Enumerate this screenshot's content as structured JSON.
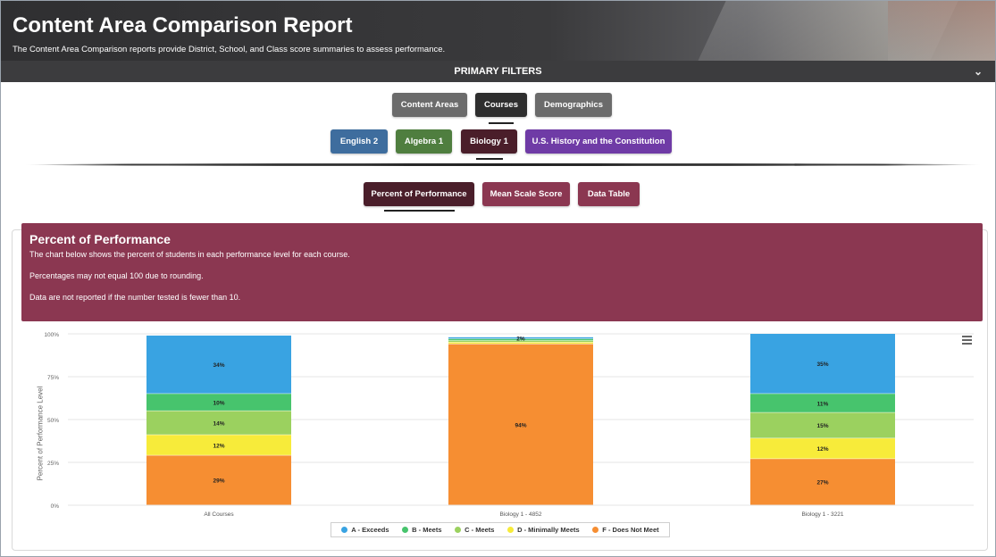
{
  "header": {
    "title": "Content Area Comparison Report",
    "subtitle": "The Content Area Comparison reports provide District, School, and Class score summaries to assess performance."
  },
  "filters_bar": {
    "label": "PRIMARY FILTERS",
    "chevron_icon": "chevron-down-icon"
  },
  "filter_tabs": [
    {
      "label": "Content Areas",
      "color": "#6b6b6b",
      "selected": false
    },
    {
      "label": "Courses",
      "color": "#2e2e2e",
      "selected": true
    },
    {
      "label": "Demographics",
      "color": "#6b6b6b",
      "selected": false
    }
  ],
  "course_tabs": [
    {
      "label": "English 2",
      "color": "#3e6d9e",
      "selected": false
    },
    {
      "label": "Algebra 1",
      "color": "#4f7e3f",
      "selected": false
    },
    {
      "label": "Biology 1",
      "color": "#4a1e2a",
      "selected": true
    },
    {
      "label": "U.S. History and the Constitution",
      "color": "#6f3ba6",
      "selected": false
    }
  ],
  "view_tabs": [
    {
      "label": "Percent of Performance",
      "color": "#4a1e2a",
      "selected": true
    },
    {
      "label": "Mean Scale Score",
      "color": "#8b3751",
      "selected": false
    },
    {
      "label": "Data Table",
      "color": "#8b3751",
      "selected": false
    }
  ],
  "info": {
    "title": "Percent of Performance",
    "line1": "The chart below shows the percent of students in each performance level for each course.",
    "line2": "Percentages may not equal 100 due to rounding.",
    "line3": "Data are not reported if the number tested is fewer than 10."
  },
  "chart_data": {
    "type": "bar",
    "stacked": true,
    "ylabel": "Percent of Performance Level",
    "ylim": [
      0,
      100
    ],
    "yticks": [
      "0%",
      "25%",
      "50%",
      "75%",
      "100%"
    ],
    "categories": [
      "All Courses",
      "Biology 1 - 4852",
      "Biology 1 - 3221"
    ],
    "series": [
      {
        "name": "F - Does Not Meet",
        "color": "#f68e32",
        "values": [
          29,
          94,
          27
        ],
        "labels": [
          "29%",
          "94%",
          "27%"
        ]
      },
      {
        "name": "D - Minimally Meets",
        "color": "#f7eb3a",
        "values": [
          12,
          1,
          12
        ],
        "labels": [
          "12%",
          "",
          "12%"
        ]
      },
      {
        "name": "C - Meets",
        "color": "#9bd15f",
        "values": [
          14,
          1,
          15
        ],
        "labels": [
          "14%",
          "",
          "15%"
        ]
      },
      {
        "name": "B - Meets",
        "color": "#47c46d",
        "values": [
          10,
          1,
          11
        ],
        "labels": [
          "10%",
          "",
          "11%"
        ]
      },
      {
        "name": "A - Exceeds",
        "color": "#39a3e2",
        "values": [
          34,
          1,
          35
        ],
        "labels": [
          "34%",
          "2%",
          "35%"
        ]
      }
    ],
    "legend": [
      {
        "name": "A - Exceeds",
        "color": "#39a3e2"
      },
      {
        "name": "B - Meets",
        "color": "#47c46d"
      },
      {
        "name": "C - Meets",
        "color": "#9bd15f"
      },
      {
        "name": "D - Minimally Meets",
        "color": "#f7eb3a"
      },
      {
        "name": "F - Does Not Meet",
        "color": "#f68e32"
      }
    ],
    "legend_position": "bottom",
    "grid": true
  }
}
